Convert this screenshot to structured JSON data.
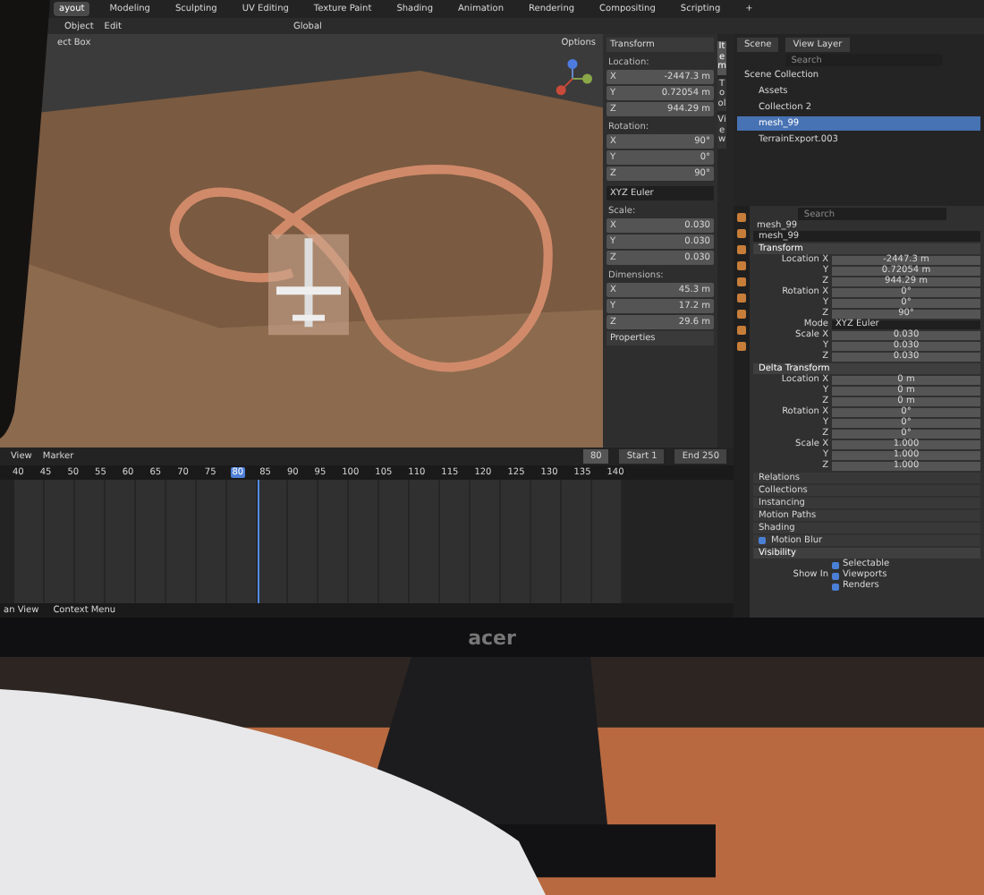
{
  "tabs": [
    {
      "label": "ayout",
      "selected": true
    },
    {
      "label": "Modeling",
      "selected": false
    },
    {
      "label": "Sculpting",
      "selected": false
    },
    {
      "label": "UV Editing",
      "selected": false
    },
    {
      "label": "Texture Paint",
      "selected": false
    },
    {
      "label": "Shading",
      "selected": false
    },
    {
      "label": "Animation",
      "selected": false
    },
    {
      "label": "Rendering",
      "selected": false
    },
    {
      "label": "Compositing",
      "selected": false
    },
    {
      "label": "Scripting",
      "selected": false
    },
    {
      "label": "+",
      "selected": false
    }
  ],
  "header": {
    "menus": [
      "Object",
      "Edit"
    ],
    "orientation": "Global",
    "options": "Options",
    "tool": "ect Box"
  },
  "sidebar": {
    "title": "Transform",
    "footer": "Properties",
    "tabs": [
      {
        "label": "Item",
        "selected": true
      },
      {
        "label": "Tool",
        "selected": false
      },
      {
        "label": "View",
        "selected": false
      }
    ],
    "rows": [
      {
        "kind": "label",
        "text": "Location:"
      },
      {
        "kind": "field",
        "axis": "X",
        "value": "-2447.3 m"
      },
      {
        "kind": "field",
        "axis": "Y",
        "value": "0.72054 m"
      },
      {
        "kind": "field",
        "axis": "Z",
        "value": "944.29 m"
      },
      {
        "kind": "label",
        "text": "Rotation:"
      },
      {
        "kind": "field",
        "axis": "X",
        "value": "90°"
      },
      {
        "kind": "field",
        "axis": "Y",
        "value": "0°"
      },
      {
        "kind": "field",
        "axis": "Z",
        "value": "90°"
      },
      {
        "kind": "dropdown",
        "value": "XYZ Euler"
      },
      {
        "kind": "label",
        "text": "Scale:"
      },
      {
        "kind": "field",
        "axis": "X",
        "value": "0.030"
      },
      {
        "kind": "field",
        "axis": "Y",
        "value": "0.030"
      },
      {
        "kind": "field",
        "axis": "Z",
        "value": "0.030"
      },
      {
        "kind": "label",
        "text": "Dimensions:"
      },
      {
        "kind": "field",
        "axis": "X",
        "value": "45.3 m"
      },
      {
        "kind": "field",
        "axis": "Y",
        "value": "17.2 m"
      },
      {
        "kind": "field",
        "axis": "Z",
        "value": "29.6 m"
      }
    ]
  },
  "outliner": {
    "scene": "Scene",
    "view_layer": "View Layer",
    "search": {
      "placeholder": "Search"
    },
    "tree": [
      {
        "label": "Scene Collection",
        "selected": false,
        "children": [
          {
            "label": "Assets",
            "selected": false
          },
          {
            "label": "Collection 2",
            "selected": false
          },
          {
            "label": "mesh_99",
            "selected": true
          },
          {
            "label": "TerrainExport.003",
            "selected": false
          }
        ]
      }
    ]
  },
  "properties": {
    "search": {
      "placeholder": "Search"
    },
    "breadcrumb": "mesh_99",
    "name": "mesh_99",
    "sections": [
      {
        "title": "Transform",
        "kind": "plain",
        "expanded": true,
        "rows": [
          {
            "kind": "field",
            "label": "Location X",
            "value": "-2447.3 m"
          },
          {
            "kind": "field",
            "label": "Y",
            "value": "0.72054 m"
          },
          {
            "kind": "field",
            "label": "Z",
            "value": "944.29 m"
          },
          {
            "kind": "field",
            "label": "Rotation X",
            "value": "0°"
          },
          {
            "kind": "field",
            "label": "Y",
            "value": "0°"
          },
          {
            "kind": "field",
            "label": "Z",
            "value": "90°"
          },
          {
            "kind": "dropdown",
            "label": "Mode",
            "value": "XYZ Euler"
          },
          {
            "kind": "field",
            "label": "Scale X",
            "value": "0.030"
          },
          {
            "kind": "field",
            "label": "Y",
            "value": "0.030"
          },
          {
            "kind": "field",
            "label": "Z",
            "value": "0.030"
          }
        ]
      },
      {
        "title": "Delta Transform",
        "kind": "plain",
        "expanded": true,
        "rows": [
          {
            "kind": "field",
            "label": "Location X",
            "value": "0 m"
          },
          {
            "kind": "field",
            "label": "Y",
            "value": "0 m"
          },
          {
            "kind": "field",
            "label": "Z",
            "value": "0 m"
          },
          {
            "kind": "field",
            "label": "Rotation X",
            "value": "0°"
          },
          {
            "kind": "field",
            "label": "Y",
            "value": "0°"
          },
          {
            "kind": "field",
            "label": "Z",
            "value": "0°"
          },
          {
            "kind": "field",
            "label": "Scale X",
            "value": "1.000"
          },
          {
            "kind": "field",
            "label": "Y",
            "value": "1.000"
          },
          {
            "kind": "field",
            "label": "Z",
            "value": "1.000"
          }
        ]
      },
      {
        "title": "Relations",
        "kind": "plain",
        "expanded": false
      },
      {
        "title": "Collections",
        "kind": "plain",
        "expanded": false
      },
      {
        "title": "Instancing",
        "kind": "plain",
        "expanded": false
      },
      {
        "title": "Motion Paths",
        "kind": "plain",
        "expanded": false
      },
      {
        "title": "Shading",
        "kind": "plain",
        "expanded": false
      },
      {
        "title": "Motion Blur",
        "kind": "toggle",
        "checked": true,
        "expanded": false
      },
      {
        "title": "Visibility",
        "kind": "plain",
        "expanded": true,
        "rows": [
          {
            "kind": "check",
            "label": "",
            "value": "Selectable",
            "checked": true
          },
          {
            "kind": "check",
            "label": "Show In",
            "value": "Viewports",
            "checked": true
          },
          {
            "kind": "check",
            "label": "",
            "value": "Renders",
            "checked": true
          }
        ]
      }
    ]
  },
  "timeline": {
    "menus": [
      "View",
      "Marker"
    ],
    "frames": [
      {
        "label": "40",
        "selected": false
      },
      {
        "label": "45",
        "selected": false
      },
      {
        "label": "50",
        "selected": false
      },
      {
        "label": "55",
        "selected": false
      },
      {
        "label": "60",
        "selected": false
      },
      {
        "label": "65",
        "selected": false
      },
      {
        "label": "70",
        "selected": false
      },
      {
        "label": "75",
        "selected": false
      },
      {
        "label": "80",
        "selected": true
      },
      {
        "label": "85",
        "selected": false
      },
      {
        "label": "90",
        "selected": false
      },
      {
        "label": "95",
        "selected": false
      },
      {
        "label": "100",
        "selected": false
      },
      {
        "label": "105",
        "selected": false
      },
      {
        "label": "110",
        "selected": false
      },
      {
        "label": "115",
        "selected": false
      },
      {
        "label": "120",
        "selected": false
      },
      {
        "label": "125",
        "selected": false
      },
      {
        "label": "130",
        "selected": false
      },
      {
        "label": "135",
        "selected": false
      },
      {
        "label": "140",
        "selected": false
      }
    ],
    "current": "80",
    "start_label": "Start",
    "start": "1",
    "end_label": "End",
    "end": "250"
  },
  "status_bar": [
    "an View",
    "Context Menu"
  ],
  "monitor": {
    "brand": "acer"
  }
}
